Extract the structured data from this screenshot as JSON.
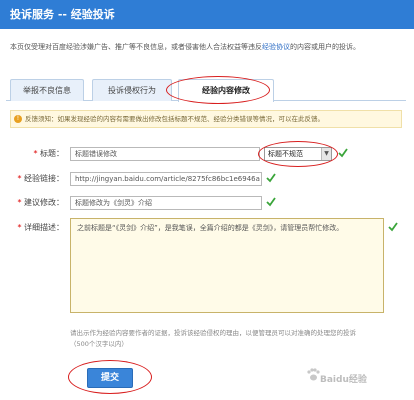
{
  "header": {
    "title": "投诉服务 -- 经验投诉",
    "bg_color": "#2f7dd5"
  },
  "intro": {
    "text_before": "本页仅受理对百度经验涉嫌广告、推广等不良信息，或者侵害他人合法权益等违反",
    "link": "经验协议",
    "text_after": "的内容或用户的投诉。"
  },
  "tabs": [
    {
      "label": "举报不良信息",
      "active": false
    },
    {
      "label": "投诉侵权行为",
      "active": false
    },
    {
      "label": "经验内容修改",
      "active": true
    }
  ],
  "notice": {
    "icon": "warning-icon",
    "text": "反馈须知：如果发现经验的内容有需要做出修改包括标题不规范、经验分类错误等情况，可以在此反馈。"
  },
  "form": {
    "title_label": "标题：",
    "title_value": "标题错误修改",
    "category_selected": "标题不规范",
    "link_label": "经验链接：",
    "link_value": "http://jingyan.baidu.com/article/8275fc86bc1e6946a",
    "suggest_label": "建议修改：",
    "suggest_value": "标题修改为《剑灵》介绍",
    "detail_label": "详细描述：",
    "detail_value": "之前标题是“《灵剑》介绍”，是我笔误，全篇介绍的都是《灵剑》，请管理员帮忙修改。",
    "required_mark": "*"
  },
  "hint": {
    "line1": "请出示作为经验内容要作者的证据，投诉该经验侵权的理由，以便管理员可以对准确的处理您的投诉",
    "line2": "（500个汉字以内）"
  },
  "submit_label": "提交",
  "watermark": {
    "text": "Baidu经验",
    "icon": "baidu-paw-icon"
  },
  "colors": {
    "annotation": "#d81e1e",
    "check": "#3aa53a",
    "link": "#2b6cc4"
  }
}
